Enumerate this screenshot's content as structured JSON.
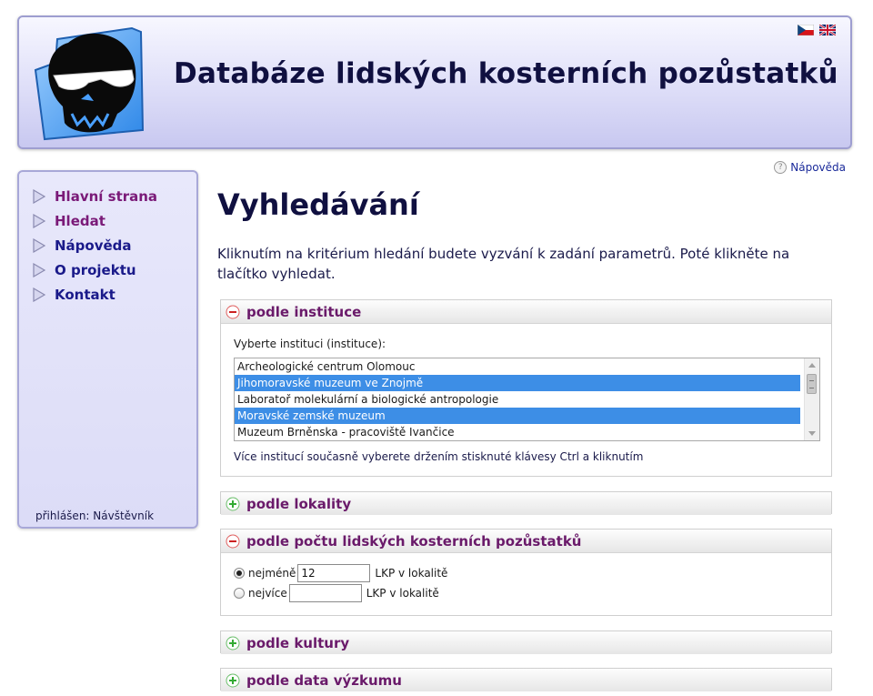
{
  "header": {
    "title": "Databáze lidských kosterních pozůstatků",
    "logo_icon": "skull-with-sunglasses-logo",
    "languages": [
      {
        "code": "cs",
        "icon": "czech-flag-icon"
      },
      {
        "code": "en",
        "icon": "uk-flag-icon"
      }
    ]
  },
  "help_link": {
    "label": "Nápověda",
    "icon": "help-question-icon"
  },
  "sidebar": {
    "items": [
      {
        "label": "Hlavní strana",
        "state": "visited"
      },
      {
        "label": "Hledat",
        "state": "visited"
      },
      {
        "label": "Nápověda",
        "state": "link"
      },
      {
        "label": "O projektu",
        "state": "link"
      },
      {
        "label": "Kontakt",
        "state": "link"
      }
    ],
    "login_status": "přihlášen: Návštěvník"
  },
  "main": {
    "title": "Vyhledávání",
    "intro": "Kliknutím na kritérium hledání budete vyzvání k zadání parametrů. Poté klikněte na tlačítko vyhledat.",
    "panels": {
      "institution": {
        "title": "podle instituce",
        "expanded": true,
        "label": "Vyberte instituci (instituce):",
        "options": [
          {
            "text": "Archeologické centrum Olomouc",
            "selected": false
          },
          {
            "text": "Jihomoravské muzeum ve Znojmě",
            "selected": true
          },
          {
            "text": "Laboratoř molekulární a biologické antropologie",
            "selected": false
          },
          {
            "text": "Moravské zemské muzeum",
            "selected": true
          },
          {
            "text": "Muzeum Brněnska - pracoviště Ivančice",
            "selected": false
          }
        ],
        "hint": "Více institucí současně vyberete držením stisknuté klávesy Ctrl a kliknutím"
      },
      "locality": {
        "title": "podle lokality",
        "expanded": false
      },
      "count": {
        "title": "podle počtu lidských kosterních pozůstatků",
        "expanded": true,
        "min_label": "nejméně",
        "min_value": "12",
        "min_suffix": "LKP v lokalitě",
        "min_checked": true,
        "max_label": "nejvíce",
        "max_value": "",
        "max_suffix": "LKP v lokalitě",
        "max_checked": false
      },
      "culture": {
        "title": "podle kultury",
        "expanded": false
      },
      "research_date": {
        "title": "podle data výzkumu",
        "expanded": false
      }
    }
  },
  "colors": {
    "header_bg": "#dedef8",
    "sidebar_bg": "#e2e2f9",
    "visited_link": "#7a1a78",
    "link": "#1a1a8a",
    "panel_title": "#6a1a6a",
    "selected_option": "#3d8ee6",
    "collapse_icon": "#cc2222",
    "expand_icon": "#33aa33"
  }
}
